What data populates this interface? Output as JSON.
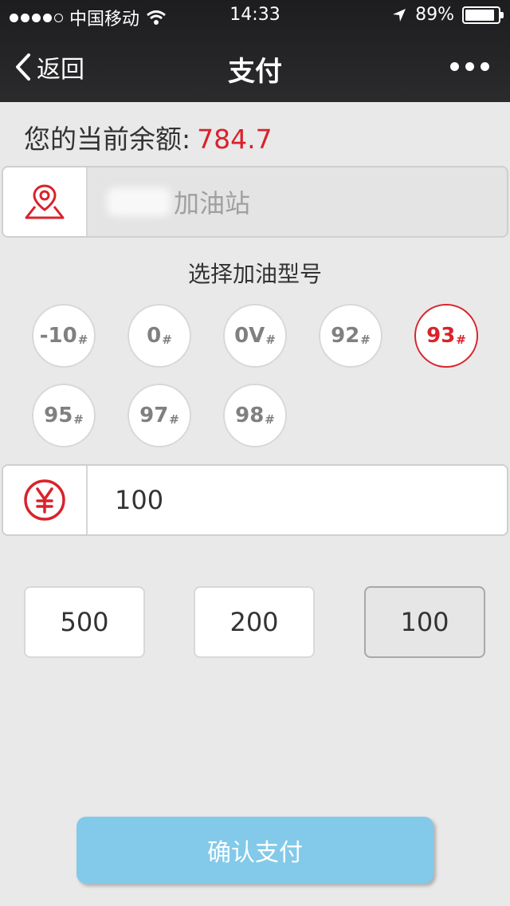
{
  "status_bar": {
    "carrier": "中国移动",
    "time": "14:33",
    "battery": "89%",
    "battery_level": 0.89,
    "signal_bars": 4
  },
  "nav": {
    "back_label": "返回",
    "title": "支付"
  },
  "balance": {
    "label": "您的当前余额:",
    "value": "784.7",
    "value_color": "#d9232c"
  },
  "station": {
    "icon": "map-pin-icon",
    "name": "加油站"
  },
  "fuel": {
    "label": "选择加油型号",
    "options": [
      {
        "label": "-10",
        "suffix": "#",
        "selected": false
      },
      {
        "label": "0",
        "suffix": "#",
        "selected": false
      },
      {
        "label": "0V",
        "suffix": "#",
        "selected": false
      },
      {
        "label": "92",
        "suffix": "#",
        "selected": false
      },
      {
        "label": "93",
        "suffix": "#",
        "selected": true
      },
      {
        "label": "95",
        "suffix": "#",
        "selected": false
      },
      {
        "label": "97",
        "suffix": "#",
        "selected": false
      },
      {
        "label": "98",
        "suffix": "#",
        "selected": false
      }
    ]
  },
  "amount": {
    "icon": "yen-icon",
    "value": "100"
  },
  "quick_amounts": [
    {
      "label": "500",
      "active": false
    },
    {
      "label": "200",
      "active": false
    },
    {
      "label": "100",
      "active": true
    }
  ],
  "confirm_label": "确认支付",
  "colors": {
    "accent": "#d9232c",
    "confirm_button": "#82c9ea",
    "nav_bg": "#232325"
  }
}
